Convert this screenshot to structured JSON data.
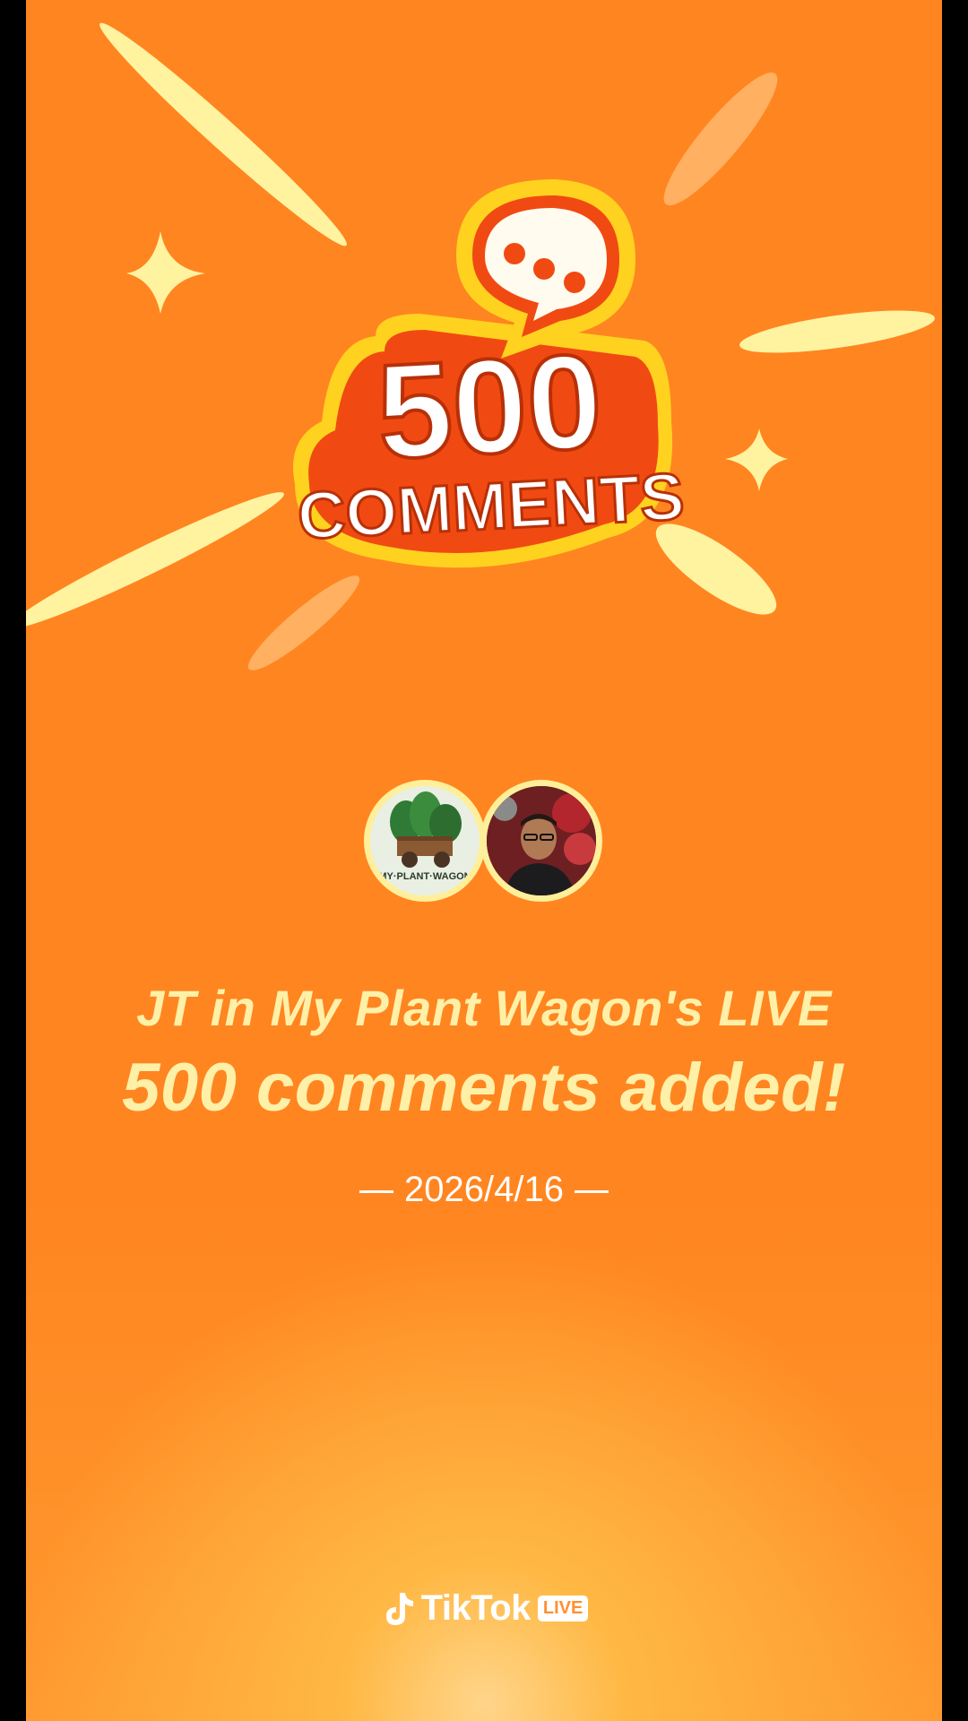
{
  "badge": {
    "number": "500",
    "word": "COMMENTS"
  },
  "avatars": [
    {
      "name": "My Plant Wagon",
      "logo_text": "MY·PLANT·WAGON"
    },
    {
      "name": "JT"
    }
  ],
  "headline": {
    "line1": "JT in My Plant Wagon's LIVE",
    "line2": "500 comments added!"
  },
  "date": "2026/4/16",
  "brand": {
    "name": "TikTok",
    "badge": "LIVE"
  },
  "colors": {
    "background": "#ff8520",
    "headline": "#fff0a8",
    "badge_red": "#f04a12",
    "badge_rim": "#ffd21f"
  },
  "icons": [
    "speech-bubble-icon",
    "sparkle-icon",
    "tiktok-note-icon"
  ]
}
